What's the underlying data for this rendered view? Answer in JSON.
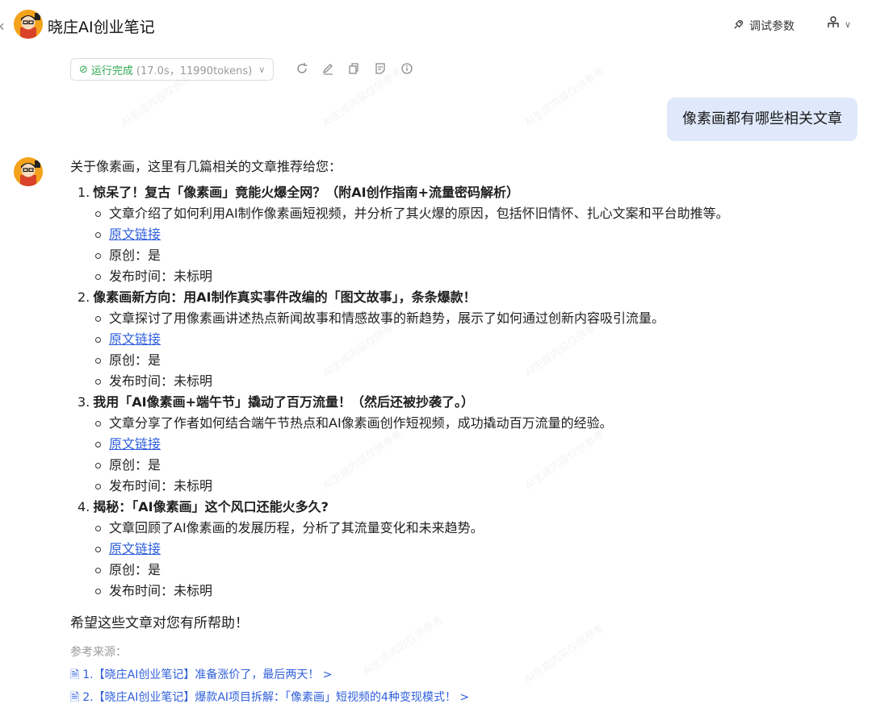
{
  "header": {
    "back_icon": "chevron-left-icon",
    "bot_name": "晓庄AI创业笔记",
    "debug_label": "调试参数",
    "debug_icon": "rocket-icon",
    "person_icon": "person-icon"
  },
  "status": {
    "label": "运行完成",
    "meta": "(17.0s，11990tokens)",
    "toolbar_icons": [
      "refresh-icon",
      "edit-icon",
      "copy-icon",
      "note-icon",
      "info-icon"
    ]
  },
  "user_message": "像素画都有哪些相关文章",
  "watermark_text": "AI生成内容仅供参考",
  "answer": {
    "intro": "关于像素画，这里有几篇相关的文章推荐给您：",
    "items": [
      {
        "number": "1.",
        "title": "惊呆了！复古「像素画」竟能火爆全网？（附AI创作指南+流量密码解析）",
        "summary": "文章介绍了如何利用AI制作像素画短视频，并分析了其火爆的原因，包括怀旧情怀、扎心文案和平台助推等。",
        "link_label": "原文链接",
        "original": "原创：是",
        "published": "发布时间：未标明"
      },
      {
        "number": "2.",
        "title": "像素画新方向：用AI制作真实事件改编的「图文故事」，条条爆款！",
        "summary": "文章探讨了用像素画讲述热点新闻故事和情感故事的新趋势，展示了如何通过创新内容吸引流量。",
        "link_label": "原文链接",
        "original": "原创：是",
        "published": "发布时间：未标明"
      },
      {
        "number": "3.",
        "title": "我用「AI像素画+端午节」撬动了百万流量！（然后还被抄袭了。）",
        "summary": "文章分享了作者如何结合端午节热点和AI像素画创作短视频，成功撬动百万流量的经验。",
        "link_label": "原文链接",
        "original": "原创：是",
        "published": "发布时间：未标明"
      },
      {
        "number": "4.",
        "title": "揭秘：「AI像素画」这个风口还能火多久?",
        "summary": "文章回顾了AI像素画的发展历程，分析了其流量变化和未来趋势。",
        "link_label": "原文链接",
        "original": "原创：是",
        "published": "发布时间：未标明"
      }
    ],
    "closing": "希望这些文章对您有所帮助！",
    "sources_label": "参考来源：",
    "sources": [
      "1.【晓庄AI创业笔记】准备涨价了，最后两天！ >",
      "2.【晓庄AI创业笔记】爆款AI项目拆解：「像素画」短视频的4种变现模式！ >"
    ]
  },
  "colors": {
    "accent_link": "#2f5fdb",
    "status_ok": "#2fa84f",
    "user_bubble": "#dfe9fb",
    "avatar_bg": "#f4a21b"
  }
}
